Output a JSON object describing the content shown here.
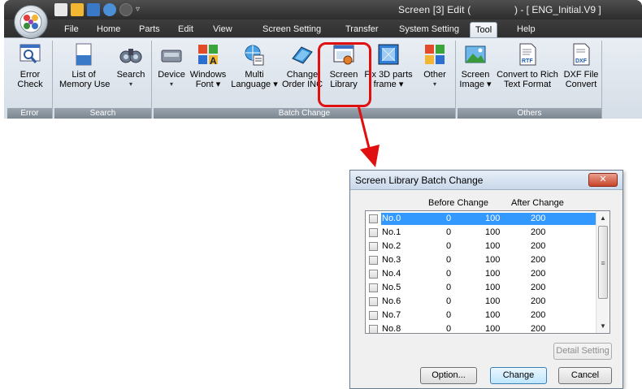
{
  "app": {
    "title": "Screen [3] Edit (",
    "document": ") - [ ENG_Initial.V9 ]",
    "tabs": [
      "File",
      "Home",
      "Parts",
      "Edit",
      "View",
      "Screen Setting",
      "Transfer",
      "System Setting",
      "Tool",
      "Help"
    ],
    "active_tab": "Tool"
  },
  "ribbon": {
    "groups": [
      {
        "label": "Error",
        "buttons": [
          {
            "line1": "Error",
            "line2": "Check",
            "icon": "error-check-icon"
          }
        ]
      },
      {
        "label": "Search",
        "buttons": [
          {
            "line1": "List of",
            "line2": "Memory Use",
            "icon": "memory-list-icon"
          },
          {
            "line1": "Search",
            "line2": "▾",
            "icon": "binoculars-icon"
          }
        ]
      },
      {
        "label": "Batch Change",
        "buttons": [
          {
            "line1": "Device",
            "line2": "▾",
            "icon": "device-icon"
          },
          {
            "line1": "Windows",
            "line2": "Font ▾",
            "icon": "windows-font-icon"
          },
          {
            "line1": "Multi",
            "line2": "Language ▾",
            "icon": "multi-language-icon"
          },
          {
            "line1": "Change",
            "line2": "Order INC",
            "icon": "change-order-icon"
          },
          {
            "line1": "Screen",
            "line2": "Library",
            "icon": "screen-library-icon"
          },
          {
            "line1": "Fix 3D parts",
            "line2": "frame ▾",
            "icon": "fix-3d-parts-icon"
          },
          {
            "line1": "Other",
            "line2": "▾",
            "icon": "other-icon"
          }
        ]
      },
      {
        "label": "Others",
        "buttons": [
          {
            "line1": "Screen",
            "line2": "Image ▾",
            "icon": "screen-image-icon"
          },
          {
            "line1": "Convert to Rich",
            "line2": "Text Format",
            "icon": "rtf-icon"
          },
          {
            "line1": "DXF File",
            "line2": "Convert",
            "icon": "dxf-icon"
          }
        ]
      }
    ]
  },
  "dialog": {
    "title": "Screen Library Batch Change",
    "close": "✕",
    "col_before": "Before Change",
    "col_after": "After Change",
    "rows": [
      {
        "no": "No.0",
        "a": "0",
        "before": "100",
        "after": "200",
        "selected": true
      },
      {
        "no": "No.1",
        "a": "0",
        "before": "100",
        "after": "200"
      },
      {
        "no": "No.2",
        "a": "0",
        "before": "100",
        "after": "200"
      },
      {
        "no": "No.3",
        "a": "0",
        "before": "100",
        "after": "200"
      },
      {
        "no": "No.4",
        "a": "0",
        "before": "100",
        "after": "200"
      },
      {
        "no": "No.5",
        "a": "0",
        "before": "100",
        "after": "200"
      },
      {
        "no": "No.6",
        "a": "0",
        "before": "100",
        "after": "200"
      },
      {
        "no": "No.7",
        "a": "0",
        "before": "100",
        "after": "200"
      },
      {
        "no": "No.8",
        "a": "0",
        "before": "100",
        "after": "200"
      }
    ],
    "detail_setting": "Detail Setting",
    "option": "Option...",
    "change": "Change",
    "cancel": "Cancel"
  },
  "colors": {
    "highlight": "#e01010",
    "selection": "#3399ff"
  }
}
